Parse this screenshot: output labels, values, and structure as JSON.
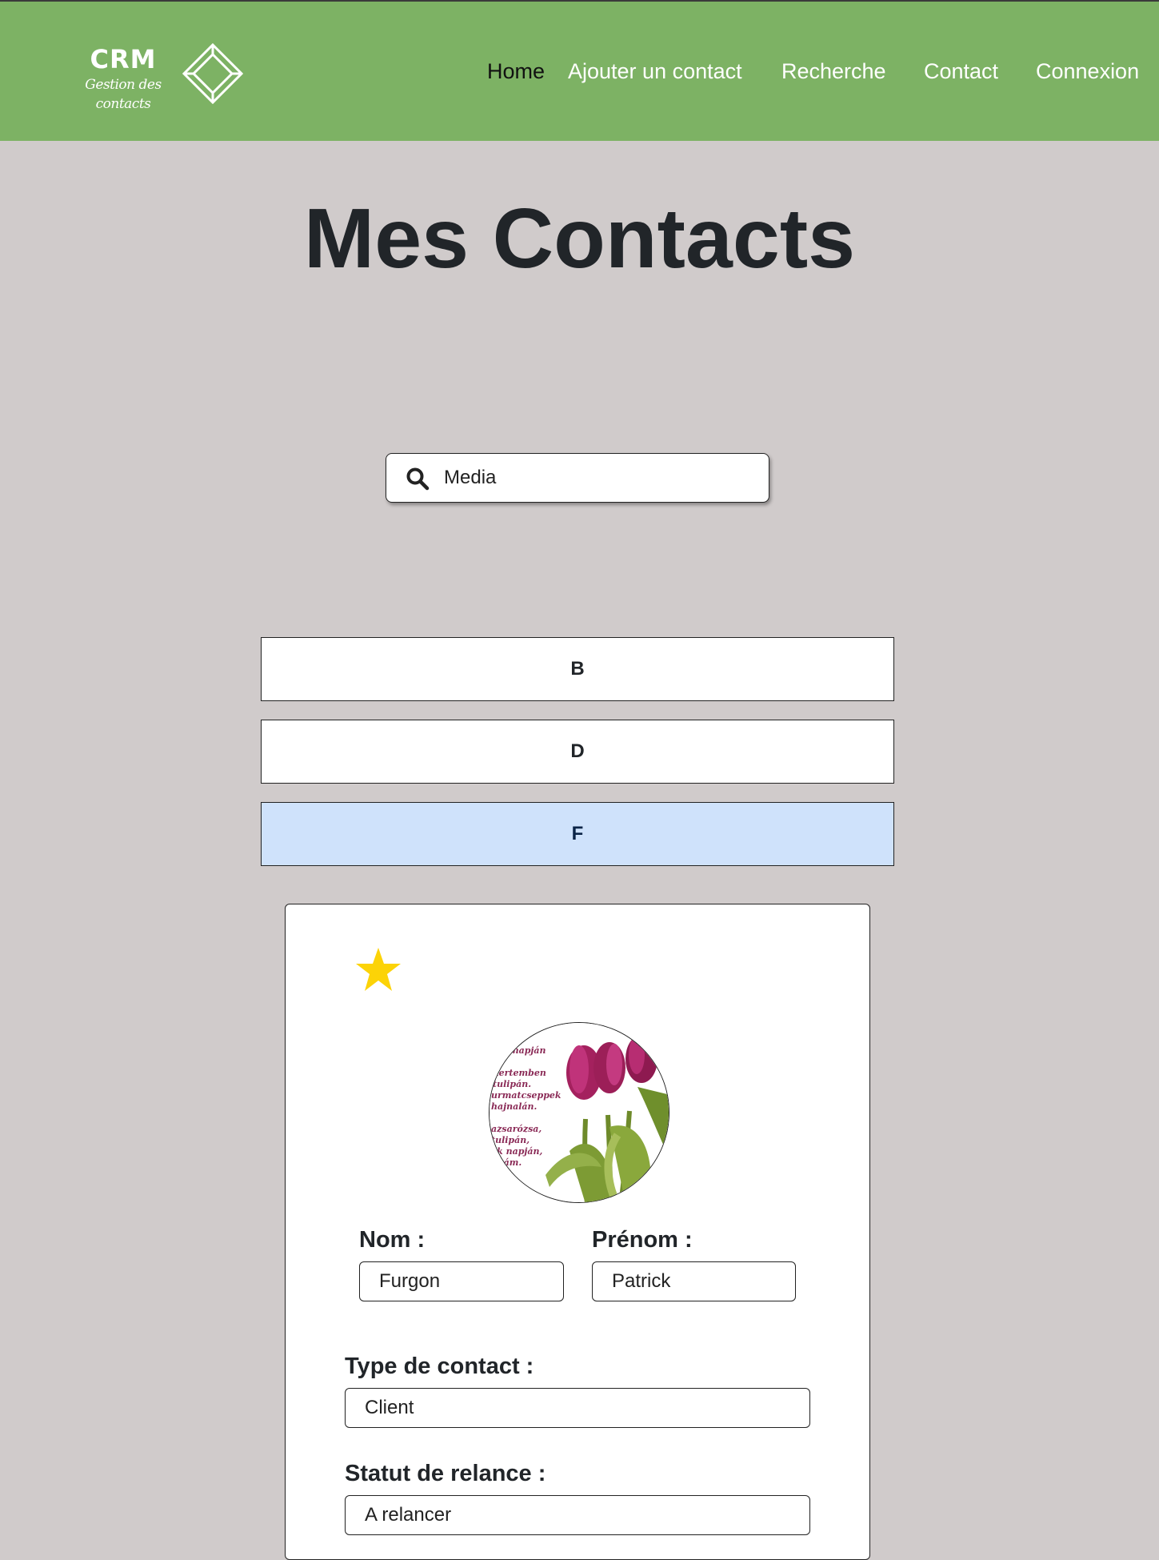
{
  "header": {
    "logo": {
      "title": "CRM",
      "subtitle": "Gestion des contacts"
    },
    "nav": [
      {
        "label": "Home",
        "active": true
      },
      {
        "label": "Ajouter un contact",
        "active": false
      },
      {
        "label": "Recherche",
        "active": false
      },
      {
        "label": "Contact",
        "active": false
      },
      {
        "label": "Connexion",
        "active": false
      }
    ],
    "colors": {
      "bar": "#7db264",
      "link": "#ffffff",
      "active_link": "#111111"
    }
  },
  "page": {
    "title": "Mes Contacts",
    "background": "#d0cbcb"
  },
  "search": {
    "value": "Media",
    "icon": "search-icon"
  },
  "letters": [
    {
      "label": "B",
      "selected": false
    },
    {
      "label": "D",
      "selected": false
    },
    {
      "label": "F",
      "selected": true
    }
  ],
  "contact": {
    "favorite": true,
    "star_color": "#fcd307",
    "avatar": "tulip-photo",
    "nom_label": "Nom :",
    "nom_value": "Furgon",
    "prenom_label": "Prénom :",
    "prenom_value": "Patrick",
    "type_label": "Type de contact :",
    "type_value": "Client",
    "statut_label": "Statut de relance :",
    "statut_value": "A relancer"
  }
}
